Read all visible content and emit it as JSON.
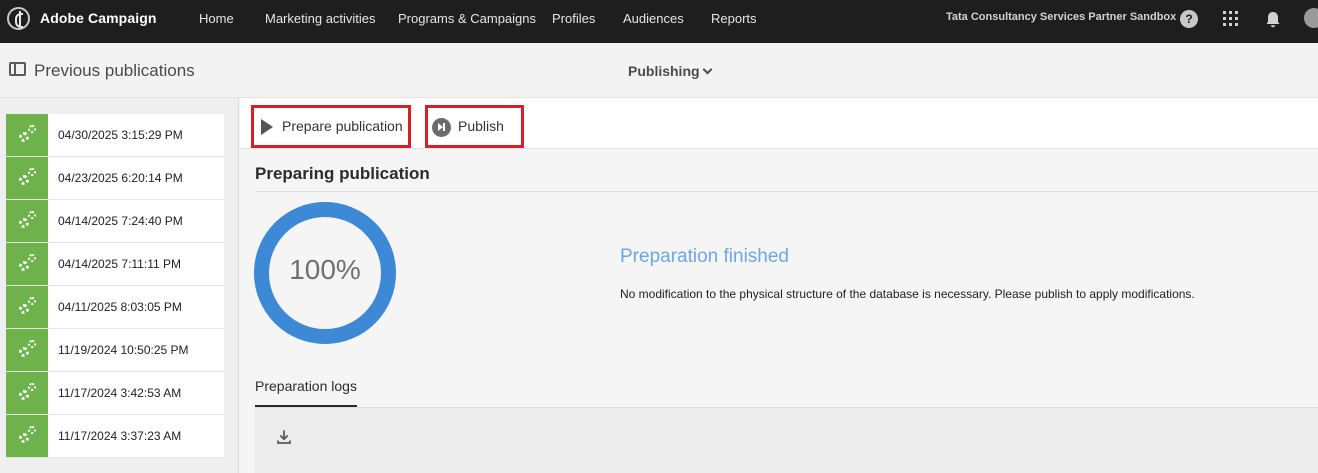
{
  "topbar": {
    "brand": "Adobe Campaign",
    "nav": [
      "Home",
      "Marketing activities",
      "Programs & Campaigns",
      "Profiles",
      "Audiences",
      "Reports"
    ],
    "organization": "Tata Consultancy Services Partner Sandbox",
    "help_glyph": "?",
    "icons": [
      "adobe-campaign-logo-icon",
      "help-icon",
      "apps-grid-icon",
      "notification-bell-icon",
      "user-avatar"
    ]
  },
  "header": {
    "title": "Previous publications",
    "menu_label": "Publishing",
    "icons": [
      "panel-toggle-icon",
      "chevron-down-icon"
    ]
  },
  "publications": [
    "04/30/2025 3:15:29 PM",
    "04/23/2025 6:20:14 PM",
    "04/14/2025 7:24:40 PM",
    "04/14/2025 7:11:11 PM",
    "04/11/2025 8:03:05 PM",
    "11/19/2024 10:50:25 PM",
    "11/17/2024 3:42:53 AM",
    "11/17/2024 3:37:23 AM"
  ],
  "toolbar": {
    "prepare_label": "Prepare publication",
    "publish_label": "Publish",
    "icons": [
      "play-icon",
      "publish-icon"
    ]
  },
  "preparation": {
    "title": "Preparing publication",
    "progress_percent": 100,
    "progress_text": "100%",
    "status_title": "Preparation finished",
    "status_message": "No modification to the physical structure of the database is necessary. Please publish to apply modifications."
  },
  "logs": {
    "tab_label": "Preparation logs",
    "icons": [
      "download-icon"
    ]
  },
  "colors": {
    "topbar": "#1e1e1e",
    "success_green": "#6db24a",
    "progress_blue": "#3e89d6",
    "status_blue": "#6ea6e6",
    "highlight_red": "#d71f2a"
  }
}
